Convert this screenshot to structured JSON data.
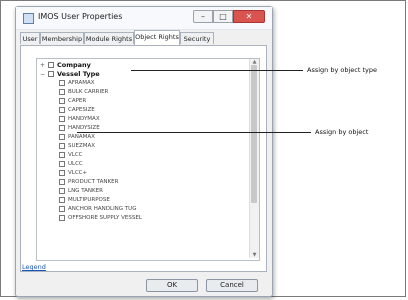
{
  "window": {
    "title": "IMOS User Properties",
    "min_glyph": "–",
    "max_glyph": "□",
    "close_glyph": "✕"
  },
  "tabs": [
    {
      "label": "User"
    },
    {
      "label": "Membership"
    },
    {
      "label": "Module Rights"
    },
    {
      "label": "Object Rights",
      "active": true
    },
    {
      "label": "Security"
    }
  ],
  "tree": {
    "company_label": "Company",
    "vessel_type_label": "Vessel Type",
    "expander_collapsed": "+",
    "expander_expanded": "−",
    "items": [
      "AFRAMAX",
      "BULK CARRIER",
      "CAPER",
      "CAPESIZE",
      "HANDYMAX",
      "HANDYSIZE",
      "PANAMAX",
      "SUEZMAX",
      "VLCC",
      "ULCC",
      "VLCC+",
      "PRODUCT TANKER",
      "LNG TANKER",
      "MULTIPURPOSE",
      "ANCHOR HANDLING TUG",
      "OFFSHORE SUPPLY VESSEL"
    ]
  },
  "legend_link": "Legend",
  "buttons": {
    "ok": "OK",
    "cancel": "Cancel"
  },
  "callouts": {
    "by_object_type": "Assign by object type",
    "by_object": "Assign by object"
  }
}
